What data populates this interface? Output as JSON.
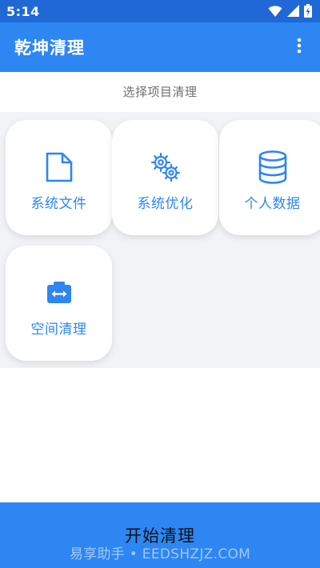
{
  "status_bar": {
    "time": "5:14",
    "icons": [
      "wifi-icon",
      "signal-icon",
      "battery-icon"
    ]
  },
  "app_bar": {
    "title": "乾坤清理",
    "menu_icon": "more-vert-icon"
  },
  "subtitle": "选择项目清理",
  "cards": [
    {
      "label": "系统文件",
      "icon": "file-icon"
    },
    {
      "label": "系统优化",
      "icon": "gears-icon"
    },
    {
      "label": "个人数据",
      "icon": "database-icon"
    },
    {
      "label": "空间清理",
      "icon": "storage-swap-icon"
    }
  ],
  "start_button": {
    "label": "开始清理"
  },
  "watermark": "易享助手 • EEDSHZJZ.COM",
  "colors": {
    "status_bar": "#1f68d6",
    "primary": "#2d86f2",
    "subtitle_text": "#6f6f6f",
    "grid_background": "#f1f3f6"
  }
}
